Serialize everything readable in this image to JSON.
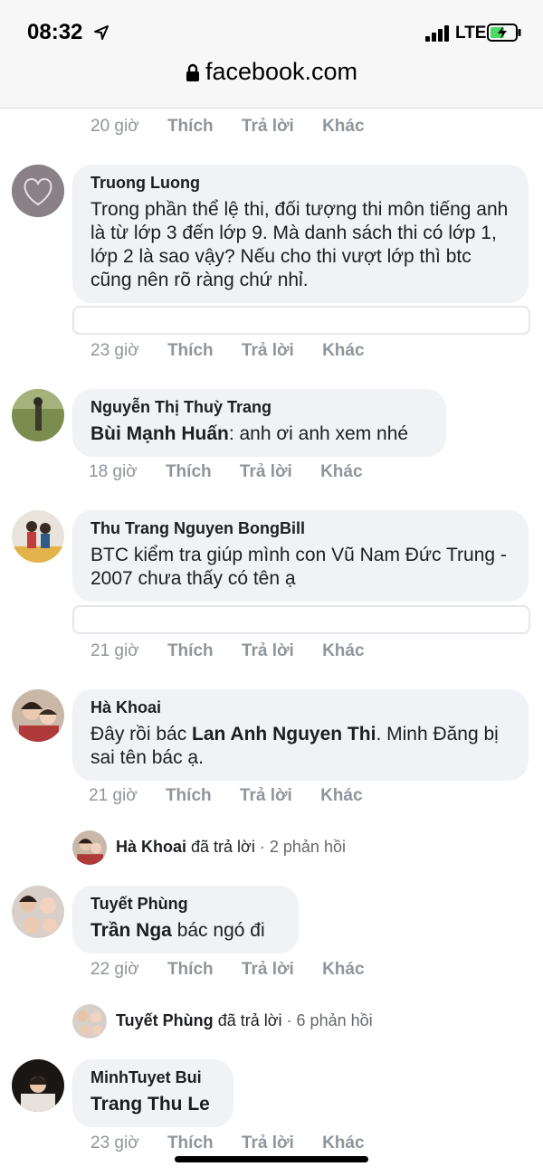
{
  "status_bar": {
    "time": "08:32",
    "network": "LTE"
  },
  "browser": {
    "url": "facebook.com"
  },
  "actions": {
    "like": "Thích",
    "reply": "Trả lời",
    "more": "Khác"
  },
  "top_meta": {
    "time": "20 giờ"
  },
  "comments": [
    {
      "author": "Truong Luong",
      "text": "Trong phần thể lệ thi, đối tượng thi môn tiếng anh là từ lớp 3 đến lớp 9. Mà danh sách thi có lớp 1, lớp 2 là sao vậy? Nếu cho thi vượt lớp thì btc cũng nên rõ ràng chứ nhỉ.",
      "time": "23 giờ"
    },
    {
      "author": "Nguyễn Thị Thuỳ Trang",
      "mention": "Bùi Mạnh Huấn",
      "text": ": anh ơi anh xem nhé",
      "time": "18 giờ"
    },
    {
      "author": "Thu Trang Nguyen BongBill",
      "text": "BTC kiểm tra giúp mình con Vũ Nam Đức Trung - 2007 chưa thấy có tên ạ",
      "time": "21 giờ"
    },
    {
      "author": "Hà Khoai",
      "text_before": "Đây rồi bác ",
      "mention": "Lan Anh Nguyen Thi",
      "text_after": ". Minh Đăng bị sai tên bác ạ.",
      "time": "21 giờ",
      "thread": {
        "name": "Hà Khoai",
        "action": "đã trả lời",
        "count": "· 2 phản hồi"
      }
    },
    {
      "author": "Tuyết Phùng",
      "mention": "Trần Nga",
      "text": " bác ngó đi",
      "time": "22 giờ",
      "thread": {
        "name": "Tuyết Phùng",
        "action": "đã trả lời",
        "count": "· 6 phản hồi"
      }
    },
    {
      "author": "MinhTuyet Bui",
      "mention": "Trang Thu Le",
      "time": "23 giờ"
    }
  ]
}
